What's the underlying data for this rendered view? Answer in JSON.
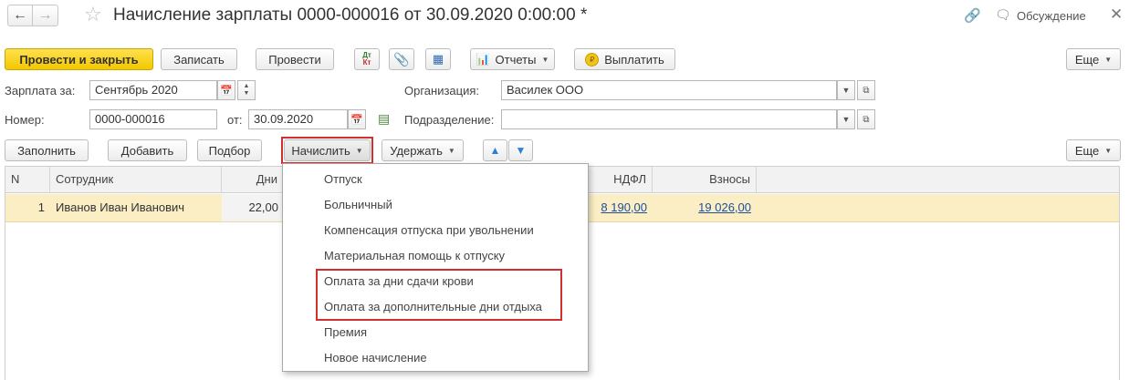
{
  "window": {
    "title": "Начисление зарплаты 0000-000016 от 30.09.2020 0:00:00 *",
    "discussion_label": "Обсуждение"
  },
  "toolbar": {
    "post_close": "Провести и закрыть",
    "save": "Записать",
    "post": "Провести",
    "dtkt_icon": "Дт Кт",
    "reports": "Отчеты",
    "pay": "Выплатить",
    "more": "Еще"
  },
  "form": {
    "salary_for_label": "Зарплата за:",
    "salary_for_value": "Сентябрь 2020",
    "number_label": "Номер:",
    "number_value": "0000-000016",
    "date_label": "от:",
    "date_value": "30.09.2020",
    "org_label": "Организация:",
    "org_value": "Василек ООО",
    "dept_label": "Подразделение:",
    "dept_value": ""
  },
  "table_toolbar": {
    "fill": "Заполнить",
    "add": "Добавить",
    "select": "Подбор",
    "accrue": "Начислить",
    "deduct": "Удержать",
    "more": "Еще"
  },
  "table": {
    "columns": [
      "N",
      "Сотрудник",
      "Дни",
      "НДФЛ",
      "Взносы"
    ],
    "rows": [
      {
        "n": "1",
        "employee": "Иванов Иван Иванович",
        "days": "22,00",
        "ndfl": "8 190,00",
        "contributions": "19 026,00"
      }
    ]
  },
  "accrue_menu": {
    "items": [
      "Отпуск",
      "Больничный",
      "Компенсация отпуска при увольнении",
      "Материальная помощь к отпуску",
      "Оплата за дни сдачи крови",
      "Оплата за дополнительные дни отдыха",
      "Премия",
      "Новое начисление"
    ],
    "highlighted": [
      "Оплата за дни сдачи крови",
      "Оплата за дополнительные дни отдыха"
    ]
  },
  "colors": {
    "primary_button": "#f3c800",
    "selected_row": "#fbeec5",
    "link": "#1a4f9c",
    "highlight_border": "#d32f2f"
  }
}
